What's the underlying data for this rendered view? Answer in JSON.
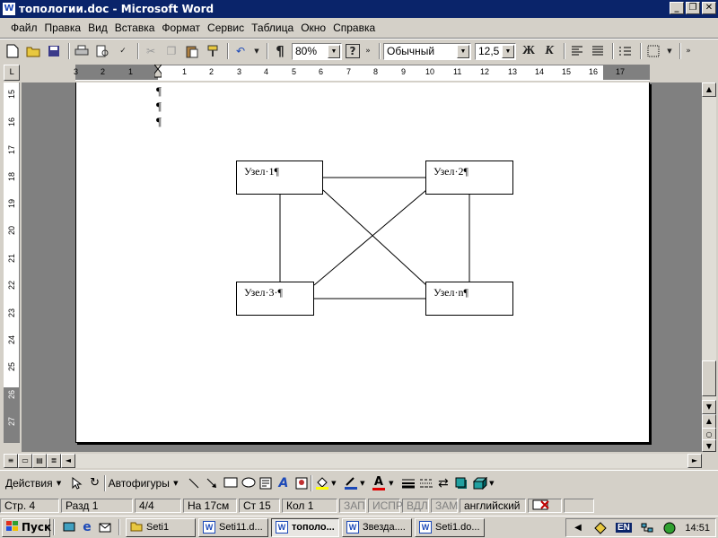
{
  "window": {
    "title": "топологии.doc - Microsoft Word",
    "minimize": "_",
    "restore": "❐",
    "close": "✕"
  },
  "menu": [
    "Файл",
    "Правка",
    "Вид",
    "Вставка",
    "Формат",
    "Сервис",
    "Таблица",
    "Окно",
    "Справка"
  ],
  "toolbar": {
    "zoom": "80%",
    "style": "Обычный",
    "font_size": "12,5",
    "bold": "Ж",
    "italic": "К",
    "pilcrow": "¶",
    "help": "?"
  },
  "ruler": {
    "horizontal_left": [
      "3",
      "2",
      "1"
    ],
    "horizontal": [
      "1",
      "2",
      "3",
      "4",
      "5",
      "6",
      "7",
      "8",
      "9",
      "10",
      "11",
      "12",
      "13",
      "14",
      "15",
      "16",
      "17"
    ],
    "vertical": [
      "15",
      "16",
      "17",
      "18",
      "19",
      "20",
      "21",
      "22",
      "23",
      "24",
      "25",
      "26",
      "27"
    ]
  },
  "document": {
    "pilcrows": [
      "¶",
      "¶",
      "¶"
    ],
    "nodes": [
      "Узел·1¶",
      "Узел·2¶",
      "Узел·3·¶",
      "Узел·n¶"
    ]
  },
  "drawing_toolbar": {
    "actions": "Действия",
    "autoshapes": "Автофигуры"
  },
  "status": {
    "page": "Стр. 4",
    "section": "Разд 1",
    "pages": "4/4",
    "at": "На 17см",
    "line": "Ст 15",
    "col": "Кол 1",
    "rec": "ЗАП",
    "trk": "ИСПР",
    "ext": "ВДЛ",
    "ovr": "ЗАМ",
    "lang": "английский"
  },
  "taskbar": {
    "start": "Пуск",
    "tasks": [
      "Seti1",
      "Seti11.d...",
      "тополо...",
      "Звезда....",
      "Seti1.do..."
    ],
    "active_index": 2,
    "lang": "EN",
    "clock": "14:51"
  },
  "colors": {
    "titlebar": "#0a246a",
    "face": "#d4d0c8",
    "docbg": "#808080"
  }
}
